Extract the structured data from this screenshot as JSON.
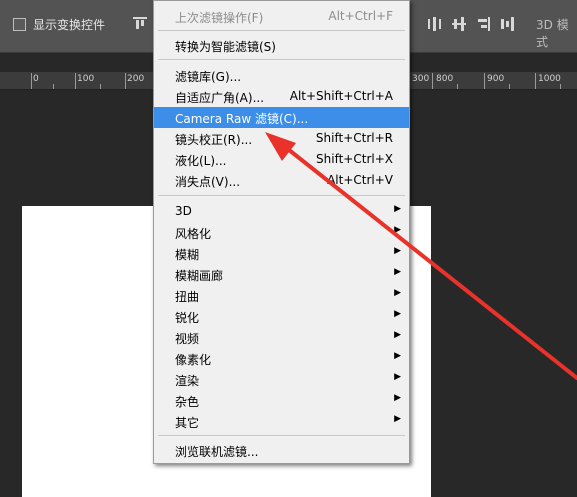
{
  "options_bar": {
    "show_transform_controls_label": "显示变换控件",
    "mode_3d_label": "3D 模式"
  },
  "ruler": {
    "marks": [
      "0",
      "100",
      "200",
      "300",
      "800",
      "900",
      "1000"
    ]
  },
  "filter_menu": {
    "items": [
      {
        "label": "上次滤镜操作(F)",
        "shortcut": "Alt+Ctrl+F"
      },
      {
        "label": "转换为智能滤镜(S)",
        "shortcut": ""
      },
      {
        "label": "滤镜库(G)...",
        "shortcut": ""
      },
      {
        "label": "自适应广角(A)...",
        "shortcut": "Alt+Shift+Ctrl+A"
      },
      {
        "label": "Camera Raw 滤镜(C)...",
        "shortcut": ""
      },
      {
        "label": "镜头校正(R)...",
        "shortcut": "Shift+Ctrl+R"
      },
      {
        "label": "液化(L)...",
        "shortcut": "Shift+Ctrl+X"
      },
      {
        "label": "消失点(V)...",
        "shortcut": "Alt+Ctrl+V"
      },
      {
        "label": "3D",
        "shortcut": ""
      },
      {
        "label": "风格化",
        "shortcut": ""
      },
      {
        "label": "模糊",
        "shortcut": ""
      },
      {
        "label": "模糊画廊",
        "shortcut": ""
      },
      {
        "label": "扭曲",
        "shortcut": ""
      },
      {
        "label": "锐化",
        "shortcut": ""
      },
      {
        "label": "视频",
        "shortcut": ""
      },
      {
        "label": "像素化",
        "shortcut": ""
      },
      {
        "label": "渲染",
        "shortcut": ""
      },
      {
        "label": "杂色",
        "shortcut": ""
      },
      {
        "label": "其它",
        "shortcut": ""
      },
      {
        "label": "浏览联机滤镜...",
        "shortcut": ""
      }
    ],
    "highlighted_item": "Camera Raw 滤镜(C)...",
    "highlight_color": "#3d8ee8",
    "submenu_arrow_icon": "triangle-right-icon"
  },
  "annotation": {
    "arrow_color": "#e8322a",
    "points_to": "Camera Raw 滤镜(C)..."
  }
}
